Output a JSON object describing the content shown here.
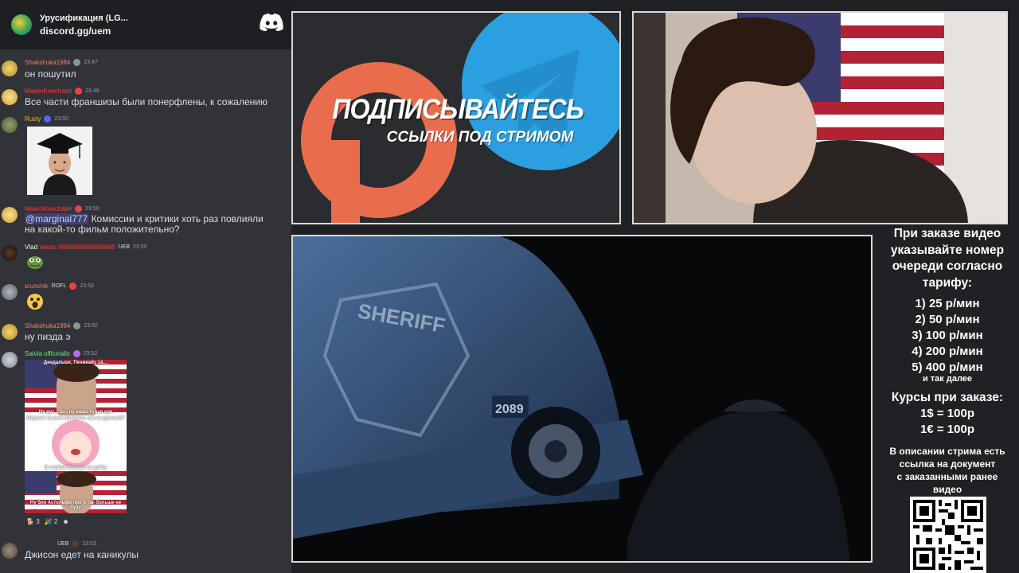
{
  "discord": {
    "server_name": "Урусификация (LG...",
    "server_link": "discord.gg/uem",
    "messages": [
      {
        "user": "Shakshuka1984",
        "time": "23:47",
        "text": "он пошутил",
        "color": "#f47b67"
      },
      {
        "user": "MaximKonchatel",
        "time": "23:48",
        "text": "Все части франшизы были понерфлены, к сожалению",
        "color": "#f23f43"
      },
      {
        "user": "Rusty",
        "time": "23:50",
        "text": "",
        "color": "#f0b232"
      },
      {
        "user": "MaximKonchatel",
        "time": "23:50",
        "mention": "@marginal777",
        "text": " Комиссии и критики хоть раз повлияли",
        "text2": "на какой-то фильм положительно?",
        "color": "#f23f43"
      },
      {
        "user": "Vlad",
        "user_extra": "кекас 6666666666666666",
        "tag": "UEB",
        "time": "23:50",
        "text": "",
        "color": "#f2f3f5"
      },
      {
        "user": "srunchik",
        "tag": "ROFL",
        "time": "23:50",
        "text": "",
        "color": "#f47b67"
      },
      {
        "user": "Shakshuka1984",
        "time": "23:50",
        "text": "ну пизда э",
        "color": "#f47b67"
      },
      {
        "user": "Salvia officinalis",
        "time": "23:52",
        "text": "",
        "color": "#57f287"
      },
      {
        "user": "",
        "tag": "UEB",
        "time": "23:53",
        "text": "Джисон едет на каникулы",
        "color": "#f2f3f5"
      }
    ],
    "meme": {
      "cap1": "Дендальше, Пенивайз 1&...",
      "cap2": "Ну рус... ээ.. ну ваще тупая хрч",
      "cap3": "Марлен ты мне говорить так не русский?",
      "cap4": "В стрйой больше не ду%у",
      "cap5": "Ну бля Астольфо про я так больше не буду"
    },
    "reactions": [
      {
        "icon": "dog-emoji",
        "count": "3"
      },
      {
        "icon": "party-emoji",
        "count": "2"
      },
      {
        "icon": "skull-emoji",
        "count": ""
      }
    ]
  },
  "promo": {
    "title": "ПОДПИСЫВАЙТЕСЬ",
    "subtitle": "ССЫЛКИ ПОД СТРИМОМ",
    "colors": {
      "patreon": "#e96c4c",
      "telegram": "#2b9fe0"
    }
  },
  "video": {
    "car_text": "SHERIFF",
    "car_number": "2089"
  },
  "info": {
    "head": [
      "При заказе видео",
      "указывайте номер",
      "очереди согласно",
      "тарифу:"
    ],
    "prices": [
      "1) 25 р/мин",
      "2) 50 р/мин",
      "3) 100 р/мин",
      "4) 200 р/мин",
      "5) 400 р/мин"
    ],
    "prices_more": "и так далее",
    "rates_title": "Курсы при заказе:",
    "rates": [
      "1$ = 100р",
      "1€ = 100р"
    ],
    "desc": [
      "В описании стрима есть",
      "ссылка на документ",
      "с заказанными ранее",
      "видео"
    ]
  }
}
